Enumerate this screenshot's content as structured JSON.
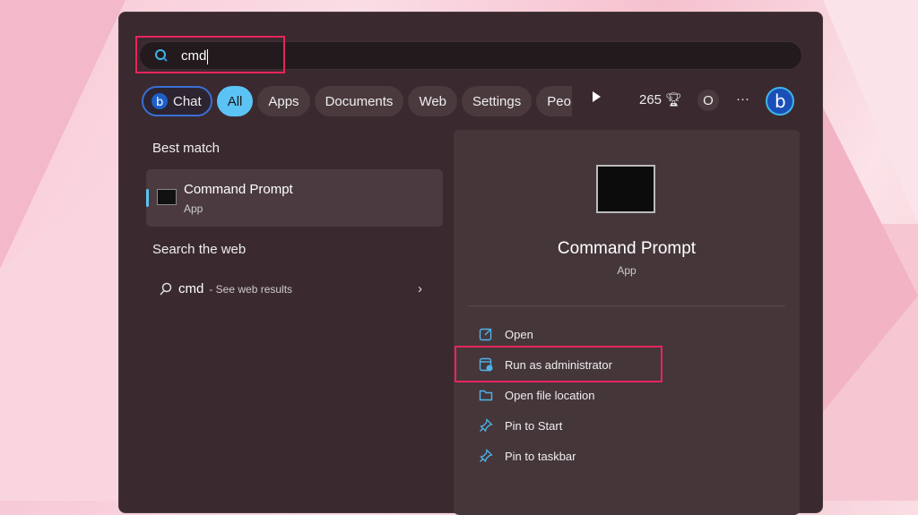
{
  "search": {
    "value": "cmd"
  },
  "filters": [
    {
      "label": "Chat"
    },
    {
      "label": "All"
    },
    {
      "label": "Apps"
    },
    {
      "label": "Documents"
    },
    {
      "label": "Web"
    },
    {
      "label": "Settings"
    },
    {
      "label": "Peo"
    }
  ],
  "toolbar": {
    "points": "265",
    "profile": "O",
    "more": "···"
  },
  "left": {
    "best_match_heading": "Best match",
    "best": {
      "title": "Command Prompt",
      "type": "App"
    },
    "web_heading": "Search the web",
    "web": {
      "query": "cmd",
      "suffix": "- See web results"
    }
  },
  "detail": {
    "title": "Command Prompt",
    "type": "App",
    "actions": [
      {
        "label": "Open"
      },
      {
        "label": "Run as administrator"
      },
      {
        "label": "Open file location"
      },
      {
        "label": "Pin to Start"
      },
      {
        "label": "Pin to taskbar"
      }
    ]
  },
  "colors": {
    "accent": "#5cc3f5",
    "highlight": "#e8245c"
  }
}
